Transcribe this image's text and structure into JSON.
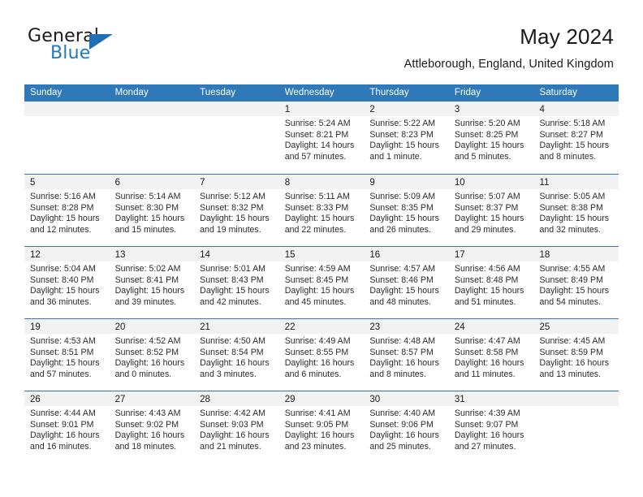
{
  "brand": {
    "word_1": "General",
    "word_2": "Blue",
    "accent_color": "#2179bf",
    "flag_color": "#1e6fb5"
  },
  "header": {
    "title": "May 2024",
    "subtitle": "Attleborough, England, United Kingdom"
  },
  "theme": {
    "header_band": "#3079b8",
    "daynum_band": "#f2f2f2",
    "row_divider": "#3079b8"
  },
  "calendar": {
    "weekday_headers": [
      "Sunday",
      "Monday",
      "Tuesday",
      "Wednesday",
      "Thursday",
      "Friday",
      "Saturday"
    ],
    "weeks": [
      [
        {
          "day": "",
          "empty": true
        },
        {
          "day": "",
          "empty": true
        },
        {
          "day": "",
          "empty": true
        },
        {
          "day": "1",
          "sunrise": "Sunrise: 5:24 AM",
          "sunset": "Sunset: 8:21 PM",
          "daylight": "Daylight: 14 hours and 57 minutes."
        },
        {
          "day": "2",
          "sunrise": "Sunrise: 5:22 AM",
          "sunset": "Sunset: 8:23 PM",
          "daylight": "Daylight: 15 hours and 1 minute."
        },
        {
          "day": "3",
          "sunrise": "Sunrise: 5:20 AM",
          "sunset": "Sunset: 8:25 PM",
          "daylight": "Daylight: 15 hours and 5 minutes."
        },
        {
          "day": "4",
          "sunrise": "Sunrise: 5:18 AM",
          "sunset": "Sunset: 8:27 PM",
          "daylight": "Daylight: 15 hours and 8 minutes."
        }
      ],
      [
        {
          "day": "5",
          "sunrise": "Sunrise: 5:16 AM",
          "sunset": "Sunset: 8:28 PM",
          "daylight": "Daylight: 15 hours and 12 minutes."
        },
        {
          "day": "6",
          "sunrise": "Sunrise: 5:14 AM",
          "sunset": "Sunset: 8:30 PM",
          "daylight": "Daylight: 15 hours and 15 minutes."
        },
        {
          "day": "7",
          "sunrise": "Sunrise: 5:12 AM",
          "sunset": "Sunset: 8:32 PM",
          "daylight": "Daylight: 15 hours and 19 minutes."
        },
        {
          "day": "8",
          "sunrise": "Sunrise: 5:11 AM",
          "sunset": "Sunset: 8:33 PM",
          "daylight": "Daylight: 15 hours and 22 minutes."
        },
        {
          "day": "9",
          "sunrise": "Sunrise: 5:09 AM",
          "sunset": "Sunset: 8:35 PM",
          "daylight": "Daylight: 15 hours and 26 minutes."
        },
        {
          "day": "10",
          "sunrise": "Sunrise: 5:07 AM",
          "sunset": "Sunset: 8:37 PM",
          "daylight": "Daylight: 15 hours and 29 minutes."
        },
        {
          "day": "11",
          "sunrise": "Sunrise: 5:05 AM",
          "sunset": "Sunset: 8:38 PM",
          "daylight": "Daylight: 15 hours and 32 minutes."
        }
      ],
      [
        {
          "day": "12",
          "sunrise": "Sunrise: 5:04 AM",
          "sunset": "Sunset: 8:40 PM",
          "daylight": "Daylight: 15 hours and 36 minutes."
        },
        {
          "day": "13",
          "sunrise": "Sunrise: 5:02 AM",
          "sunset": "Sunset: 8:41 PM",
          "daylight": "Daylight: 15 hours and 39 minutes."
        },
        {
          "day": "14",
          "sunrise": "Sunrise: 5:01 AM",
          "sunset": "Sunset: 8:43 PM",
          "daylight": "Daylight: 15 hours and 42 minutes."
        },
        {
          "day": "15",
          "sunrise": "Sunrise: 4:59 AM",
          "sunset": "Sunset: 8:45 PM",
          "daylight": "Daylight: 15 hours and 45 minutes."
        },
        {
          "day": "16",
          "sunrise": "Sunrise: 4:57 AM",
          "sunset": "Sunset: 8:46 PM",
          "daylight": "Daylight: 15 hours and 48 minutes."
        },
        {
          "day": "17",
          "sunrise": "Sunrise: 4:56 AM",
          "sunset": "Sunset: 8:48 PM",
          "daylight": "Daylight: 15 hours and 51 minutes."
        },
        {
          "day": "18",
          "sunrise": "Sunrise: 4:55 AM",
          "sunset": "Sunset: 8:49 PM",
          "daylight": "Daylight: 15 hours and 54 minutes."
        }
      ],
      [
        {
          "day": "19",
          "sunrise": "Sunrise: 4:53 AM",
          "sunset": "Sunset: 8:51 PM",
          "daylight": "Daylight: 15 hours and 57 minutes."
        },
        {
          "day": "20",
          "sunrise": "Sunrise: 4:52 AM",
          "sunset": "Sunset: 8:52 PM",
          "daylight": "Daylight: 16 hours and 0 minutes."
        },
        {
          "day": "21",
          "sunrise": "Sunrise: 4:50 AM",
          "sunset": "Sunset: 8:54 PM",
          "daylight": "Daylight: 16 hours and 3 minutes."
        },
        {
          "day": "22",
          "sunrise": "Sunrise: 4:49 AM",
          "sunset": "Sunset: 8:55 PM",
          "daylight": "Daylight: 16 hours and 6 minutes."
        },
        {
          "day": "23",
          "sunrise": "Sunrise: 4:48 AM",
          "sunset": "Sunset: 8:57 PM",
          "daylight": "Daylight: 16 hours and 8 minutes."
        },
        {
          "day": "24",
          "sunrise": "Sunrise: 4:47 AM",
          "sunset": "Sunset: 8:58 PM",
          "daylight": "Daylight: 16 hours and 11 minutes."
        },
        {
          "day": "25",
          "sunrise": "Sunrise: 4:45 AM",
          "sunset": "Sunset: 8:59 PM",
          "daylight": "Daylight: 16 hours and 13 minutes."
        }
      ],
      [
        {
          "day": "26",
          "sunrise": "Sunrise: 4:44 AM",
          "sunset": "Sunset: 9:01 PM",
          "daylight": "Daylight: 16 hours and 16 minutes."
        },
        {
          "day": "27",
          "sunrise": "Sunrise: 4:43 AM",
          "sunset": "Sunset: 9:02 PM",
          "daylight": "Daylight: 16 hours and 18 minutes."
        },
        {
          "day": "28",
          "sunrise": "Sunrise: 4:42 AM",
          "sunset": "Sunset: 9:03 PM",
          "daylight": "Daylight: 16 hours and 21 minutes."
        },
        {
          "day": "29",
          "sunrise": "Sunrise: 4:41 AM",
          "sunset": "Sunset: 9:05 PM",
          "daylight": "Daylight: 16 hours and 23 minutes."
        },
        {
          "day": "30",
          "sunrise": "Sunrise: 4:40 AM",
          "sunset": "Sunset: 9:06 PM",
          "daylight": "Daylight: 16 hours and 25 minutes."
        },
        {
          "day": "31",
          "sunrise": "Sunrise: 4:39 AM",
          "sunset": "Sunset: 9:07 PM",
          "daylight": "Daylight: 16 hours and 27 minutes."
        },
        {
          "day": "",
          "empty": true
        }
      ]
    ]
  }
}
